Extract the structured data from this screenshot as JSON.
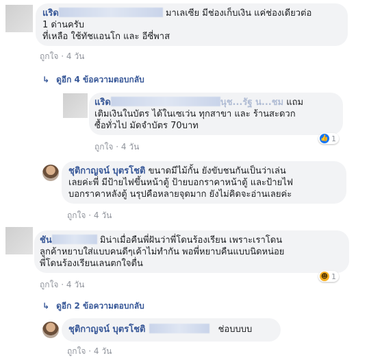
{
  "comments": [
    {
      "author": "แริด",
      "text_lines": [
        "มาเลเซีย มีช่องเก็บเงิน แค่ช่องเดียวต่อ",
        "1 ด่านครับ",
        "ที่เหลือ ใช้ทัชแอนโก และ อีซี่พาส"
      ],
      "like_label": "ถูกใจ",
      "time": "4 วัน",
      "replies_link": "ดูอีก 4 ข้อความตอบกลับ"
    },
    {
      "author": "แริด",
      "tag_suffix": "นุช...รัฐ น...ชม",
      "text_lines": [
        "แถม",
        "เติมเงินในบัตร ได้ในเซเว่น ทุกสาขา และ ร้านสะดวก",
        "ซื้อทั่วไป มัดจำบัตร 70บาท"
      ],
      "like_label": "ถูกใจ",
      "time": "4 วัน",
      "reaction_count": "1"
    },
    {
      "author": "ชุติกาญจน์ บุตรโชติ",
      "text_lines": [
        "ขนาดมีไม้กั้น ยังขับชนกันเป็นว่าเล่น",
        "เลยค่ะพี่ มีป้ายไฟขึ้นหน้าตู้ ป้ายบอกราคาหน้าตู้ และป้ายไฟ",
        "บอกราคาหลังตู้ นรุปคือหลายจุดมาก ยังไม่คิดจะอ่านเลยค่ะ"
      ],
      "like_label": "ถูกใจ",
      "time": "4 วัน"
    },
    {
      "author": "ชัน",
      "text_lines": [
        "มิน่าเมื่อคืนพี่ฝันว่าพี่โดนร้องเรียน เพราะเราโดน",
        "ลูกค้าหยาบใส่แบบคนดีๆเค้าไม่ทำกัน พอพี่หยาบคืนแบบนิดหน่อย",
        "พี่โดนร้องเรียนเลนตกใจตื่น"
      ],
      "like_label": "ถูกใจ",
      "time": "4 วัน",
      "reaction_count": "1",
      "replies_link": "ดูอีก 2 ข้อความตอบกลับ"
    },
    {
      "author": "ชุติกาญจน์ บุตรโชติ",
      "text_lines": [
        "ช่อบบบบ"
      ],
      "like_label": "ถูกใจ",
      "time": "4 วัน"
    }
  ],
  "dot": "·",
  "reply_arrow": "↳"
}
